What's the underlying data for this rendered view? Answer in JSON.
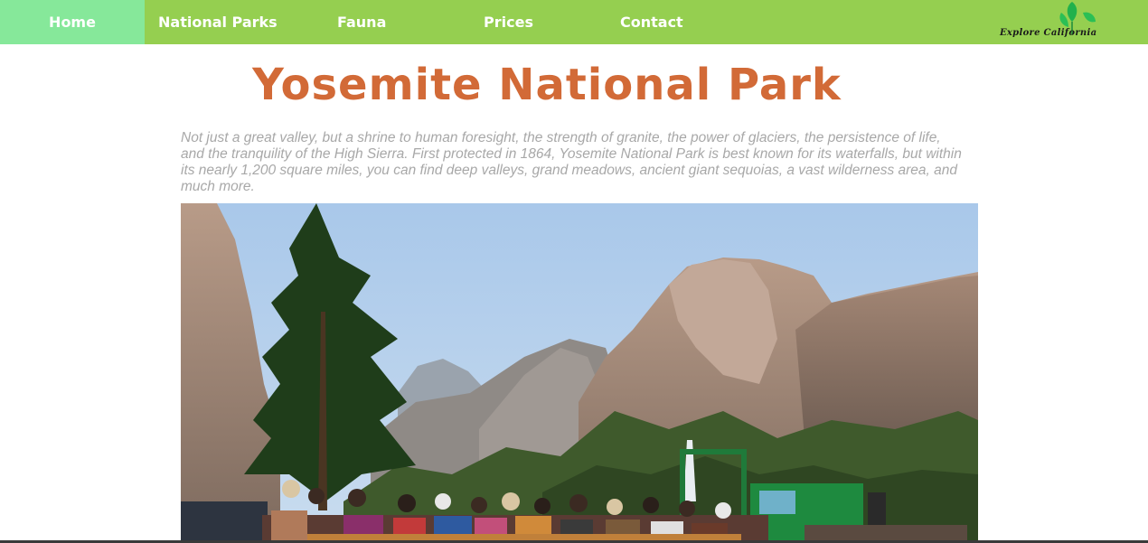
{
  "nav": {
    "items": [
      {
        "label": "Home",
        "active": true
      },
      {
        "label": "National Parks",
        "active": false
      },
      {
        "label": "Fauna",
        "active": false
      },
      {
        "label": "Prices",
        "active": false
      },
      {
        "label": "Contact",
        "active": false
      }
    ],
    "logo_text": "Explore California"
  },
  "page": {
    "title": "Yosemite National Park",
    "intro": "Not just a great valley, but a shrine to human foresight, the strength of granite, the power of glaciers, the persistence of life, and the tranquility of the High Sierra. First protected in 1864, Yosemite National Park is best known for its waterfalls, but within its nearly 1,200 square miles, you can find deep valleys, grand meadows, ancient giant sequoias, a vast wilderness area, and much more."
  },
  "colors": {
    "nav_bg": "#95cf50",
    "nav_active": "#86e89a",
    "title": "#d26a37",
    "intro_text": "#a8a8a8"
  },
  "icons": [
    "leaf-logo-icon"
  ]
}
